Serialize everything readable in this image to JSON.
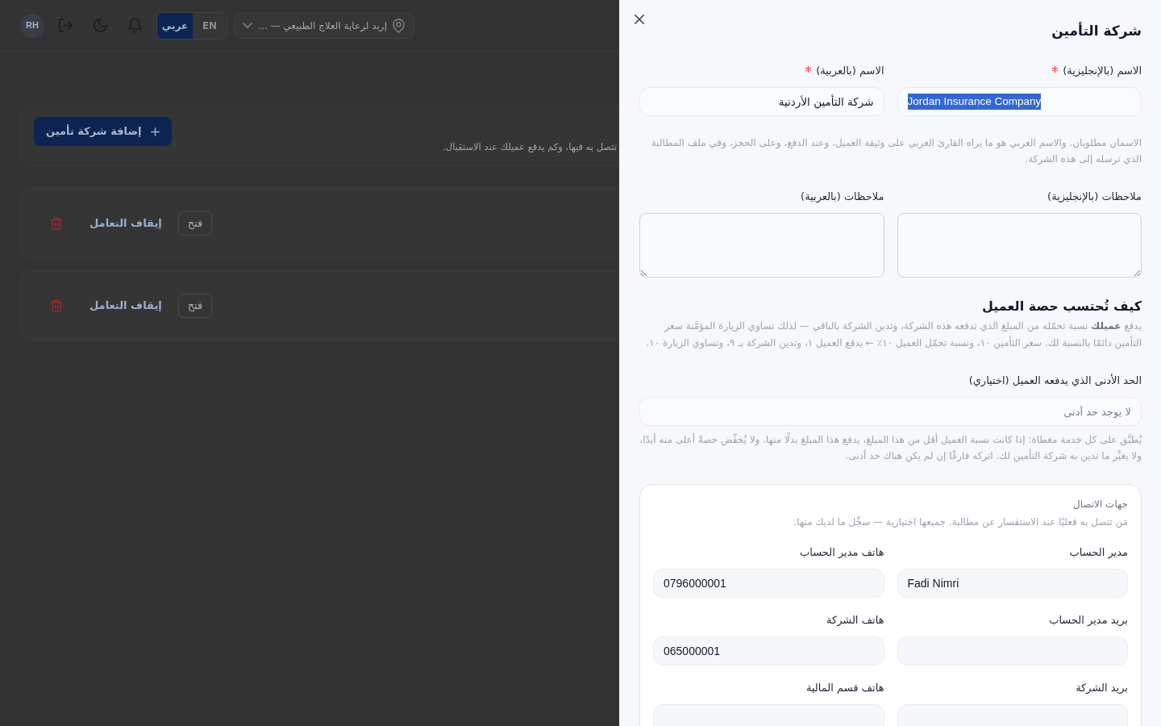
{
  "top_bar": {
    "location": {
      "value": "إربد لرعاية العلاج الطبيعي — ..."
    },
    "language_options": [
      {
        "label": "EN",
        "selected": false
      },
      {
        "label": "عربي",
        "selected": true
      }
    ],
    "avatar_initials": "RH"
  },
  "page_header": {
    "description": "تتصل به فيها، وكم يدفع عميلك عند الاستقبال.",
    "add_button": "إضافة شركة تأمين"
  },
  "company_rows": [
    {
      "open_button": "فتح",
      "suspend_link": "إيقاف التعامل"
    },
    {
      "open_button": "فتح",
      "suspend_link": "إيقاف التعامل"
    }
  ],
  "drawer": {
    "title": "شركة التأمين",
    "name_fields": [
      {
        "label": "الاسم (بالإنجليزية)",
        "required": true,
        "rtl": false,
        "value": "Jordan Insurance Company",
        "value_selected": true
      },
      {
        "label": "الاسم (بالعربية)",
        "required": true,
        "rtl": true,
        "value": "شركة التأمين الأردنية",
        "value_selected": false
      }
    ],
    "name_hint": "الاسمان مطلوبان. والاسم العربي هو ما يراه القارئ العربي على وثيقة العميل، وعند الدفع، وعلى الحجز، وفي ملف المطالبة الذي ترسله إلى هذه الشركة.",
    "notes_fields": [
      {
        "label": "ملاحظات (بالإنجليزية)",
        "rtl": false
      },
      {
        "label": "ملاحظات (بالعربية)",
        "rtl": true
      }
    ],
    "client_share": {
      "heading": "كيف تُحتسب حصة العميل",
      "text": "يدفع **عميلك** نسبة تحمّله من المبلغ الذي تدفعه هذه الشركة، وتدين الشركة بالباقي — لذلك تساوي الزيارة المؤمَّنة سعر التأمين دائمًا بالنسبة لك. سعر التأمين ١٠، ونسبة تحمّل العميل ١٠٪ ← يدفع العميل ١، وتدين الشركة بـ ٩، وتساوي الزيارة ١٠."
    },
    "minimum_field": {
      "label": "الحد الأدنى الذي يدفعه العميل (اختياري)",
      "placeholder": "لا يوجد حد أدنى",
      "hint": "يُطبَّق على كل خدمة مغطاة: إذا كانت نسبة العميل أقل من هذا المبلغ، يدفع هذا المبلغ بدلًا منها. ولا يُخفِّض حصةً أعلى منه أبدًا، ولا يغيِّر ما تدين به شركة التأمين لك. اتركه فارغًا إن لم يكن هناك حد أدنى."
    },
    "contacts": {
      "heading": "جهات الاتصال",
      "description": "مَن تتصل به فعليًا عند الاستفسار عن مطالبة. جميعها اختيارية — سجِّل ما لديك منها.",
      "fields": [
        {
          "label": "مدير الحساب",
          "value": "Fadi Nimri"
        },
        {
          "label": "هاتف مدير الحساب",
          "value": "0796000001"
        },
        {
          "label": "بريد مدير الحساب"
        },
        {
          "label": "هاتف الشركة",
          "value": "065000001"
        },
        {
          "label": "بريد الشركة"
        },
        {
          "label": "هاتف قسم المالية"
        }
      ]
    }
  }
}
